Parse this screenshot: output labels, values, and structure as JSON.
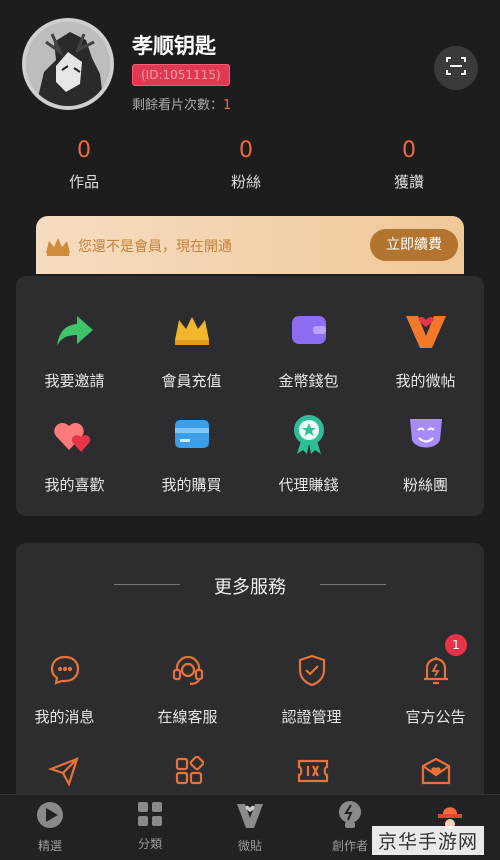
{
  "profile": {
    "username": "孝顺钥匙",
    "user_id": "(ID:1051115)",
    "views_label": "剩餘看片次數：",
    "views_value": "1"
  },
  "stats": [
    {
      "value": "0",
      "label": "作品"
    },
    {
      "value": "0",
      "label": "粉絲"
    },
    {
      "value": "0",
      "label": "獲讚"
    }
  ],
  "vip": {
    "text": "您還不是會員，現在開通",
    "button": "立即續費"
  },
  "features": [
    {
      "label": "我要邀請",
      "icon": "share-arrow-icon"
    },
    {
      "label": "會員充值",
      "icon": "crown-icon"
    },
    {
      "label": "金幣錢包",
      "icon": "wallet-icon"
    },
    {
      "label": "我的微帖",
      "icon": "heart-v-icon"
    },
    {
      "label": "我的喜歡",
      "icon": "hearts-icon"
    },
    {
      "label": "我的購買",
      "icon": "card-icon"
    },
    {
      "label": "代理賺錢",
      "icon": "medal-icon"
    },
    {
      "label": "粉絲團",
      "icon": "mask-icon"
    }
  ],
  "more_services": {
    "title": "更多服務",
    "items": [
      {
        "label": "我的消息",
        "icon": "message-icon"
      },
      {
        "label": "在線客服",
        "icon": "headset-icon"
      },
      {
        "label": "認證管理",
        "icon": "shield-check-icon"
      },
      {
        "label": "官方公告",
        "icon": "bell-icon"
      }
    ],
    "badge": "1"
  },
  "tabs": [
    {
      "label": "精選",
      "icon": "play-icon"
    },
    {
      "label": "分類",
      "icon": "grid-icon"
    },
    {
      "label": "微貼",
      "icon": "v-icon"
    },
    {
      "label": "創作者",
      "icon": "bulb-icon"
    },
    {
      "label": "我",
      "icon": "profile-hat-icon"
    }
  ],
  "watermark": "京华手游网",
  "colors": {
    "accent": "#f0693b",
    "vip_gold": "#b2742e",
    "badge": "#e93348"
  }
}
